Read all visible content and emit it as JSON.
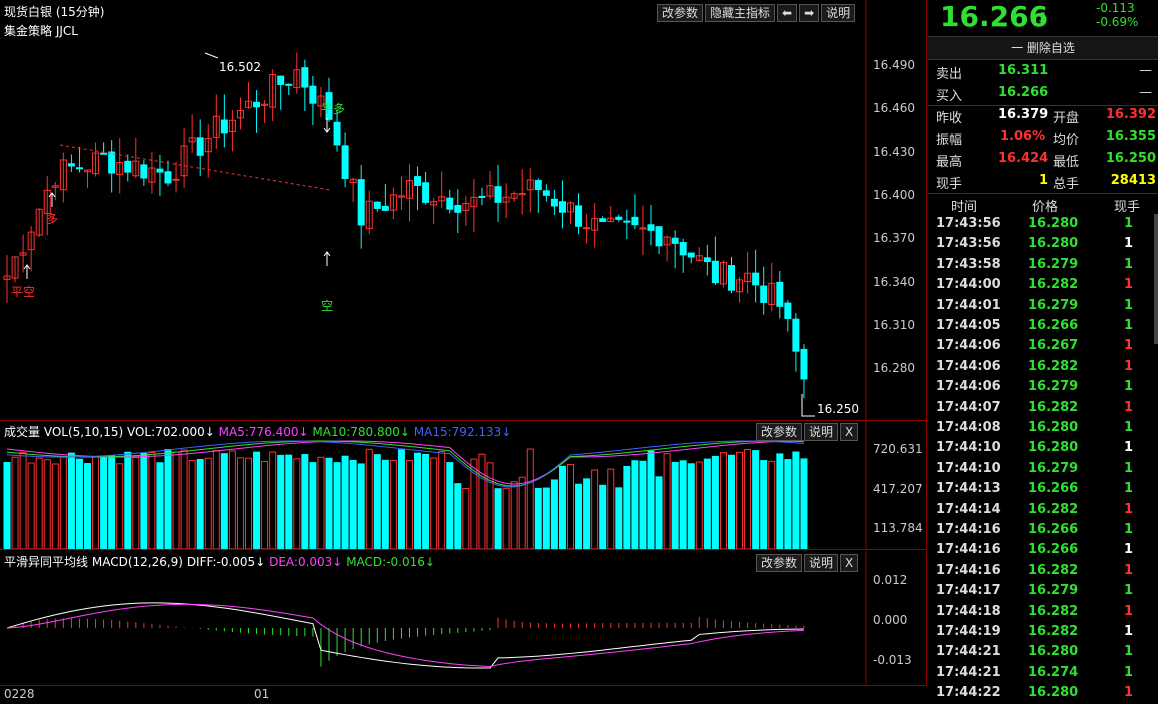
{
  "main": {
    "title": "现货白银 (15分钟)",
    "strategy": "集金策略 JJCL",
    "buttons": [
      "改参数",
      "隐藏主指标",
      "⬅",
      "➡",
      "说明"
    ],
    "price_labels": [
      "16.490",
      "16.460",
      "16.430",
      "16.400",
      "16.370",
      "16.340",
      "16.310",
      "16.280"
    ],
    "high_mark": "16.502",
    "low_mark": "16.250",
    "signals": [
      {
        "text": "平空",
        "color": "#ff3030"
      },
      {
        "text": "多",
        "color": "#ff3030"
      },
      {
        "text": "平多",
        "color": "#30e030"
      },
      {
        "text": "空",
        "color": "#30e030"
      }
    ]
  },
  "volume": {
    "title": "成交量",
    "params": "VOL(5,10,15)",
    "vol": "VOL:702.000↓",
    "ma5": "MA5:776.400↓",
    "ma10": "MA10:780.800↓",
    "ma15": "MA15:792.133↓",
    "buttons": [
      "改参数",
      "说明",
      "X"
    ],
    "axis_labels": [
      "720.631",
      "417.207",
      "113.784"
    ]
  },
  "macd": {
    "title": "平滑异同平均线",
    "params": "MACD(12,26,9)",
    "diff": "DIFF:-0.005↓",
    "dea": "DEA:0.003↓",
    "macd": "MACD:-0.016↓",
    "buttons": [
      "改参数",
      "说明",
      "X"
    ],
    "axis_labels": [
      "0.012",
      "0.000",
      "-0.013"
    ]
  },
  "date_labels": [
    "0228",
    "01"
  ],
  "colors": {
    "up": "#ff3030",
    "down": "#00ffff",
    "green": "#30e030",
    "yellow": "#ffff00",
    "magenta": "#ff40ff",
    "blue": "#4060ff"
  },
  "quote": {
    "price": "16.266",
    "arrow": "⬇",
    "change": "-0.113",
    "change_pct": "-0.69%",
    "delete_label": "一 删除自选",
    "sell_label": "卖出",
    "sell_price": "16.311",
    "sell_vol": "—",
    "buy_label": "买入",
    "buy_price": "16.266",
    "buy_vol": "—",
    "prev_close_label": "昨收",
    "prev_close": "16.379",
    "open_label": "开盘",
    "open": "16.392",
    "amplitude_label": "振幅",
    "amplitude": "1.06%",
    "avg_label": "均价",
    "avg": "16.355",
    "high_label": "最高",
    "high": "16.424",
    "low_label": "最低",
    "low": "16.250",
    "cur_vol_label": "现手",
    "cur_vol": "1",
    "total_vol_label": "总手",
    "total_vol": "28413"
  },
  "ticks_header": {
    "time": "时间",
    "price": "价格",
    "vol": "现手"
  },
  "ticks": [
    {
      "time": "17:43:56",
      "price": "16.280",
      "vol": "1",
      "color": "#30e030"
    },
    {
      "time": "17:43:56",
      "price": "16.280",
      "vol": "1",
      "color": "#ffffff"
    },
    {
      "time": "17:43:58",
      "price": "16.279",
      "vol": "1",
      "color": "#30e030"
    },
    {
      "time": "17:44:00",
      "price": "16.282",
      "vol": "1",
      "color": "#ff3030"
    },
    {
      "time": "17:44:01",
      "price": "16.279",
      "vol": "1",
      "color": "#30e030"
    },
    {
      "time": "17:44:05",
      "price": "16.266",
      "vol": "1",
      "color": "#30e030"
    },
    {
      "time": "17:44:06",
      "price": "16.267",
      "vol": "1",
      "color": "#ff3030"
    },
    {
      "time": "17:44:06",
      "price": "16.282",
      "vol": "1",
      "color": "#ff3030"
    },
    {
      "time": "17:44:06",
      "price": "16.279",
      "vol": "1",
      "color": "#30e030"
    },
    {
      "time": "17:44:07",
      "price": "16.282",
      "vol": "1",
      "color": "#ff3030"
    },
    {
      "time": "17:44:08",
      "price": "16.280",
      "vol": "1",
      "color": "#30e030"
    },
    {
      "time": "17:44:10",
      "price": "16.280",
      "vol": "1",
      "color": "#ffffff"
    },
    {
      "time": "17:44:10",
      "price": "16.279",
      "vol": "1",
      "color": "#30e030"
    },
    {
      "time": "17:44:13",
      "price": "16.266",
      "vol": "1",
      "color": "#30e030"
    },
    {
      "time": "17:44:14",
      "price": "16.282",
      "vol": "1",
      "color": "#ff3030"
    },
    {
      "time": "17:44:16",
      "price": "16.266",
      "vol": "1",
      "color": "#30e030"
    },
    {
      "time": "17:44:16",
      "price": "16.266",
      "vol": "1",
      "color": "#ffffff"
    },
    {
      "time": "17:44:16",
      "price": "16.282",
      "vol": "1",
      "color": "#ff3030"
    },
    {
      "time": "17:44:17",
      "price": "16.279",
      "vol": "1",
      "color": "#30e030"
    },
    {
      "time": "17:44:18",
      "price": "16.282",
      "vol": "1",
      "color": "#ff3030"
    },
    {
      "time": "17:44:19",
      "price": "16.282",
      "vol": "1",
      "color": "#ffffff"
    },
    {
      "time": "17:44:21",
      "price": "16.280",
      "vol": "1",
      "color": "#30e030"
    },
    {
      "time": "17:44:21",
      "price": "16.274",
      "vol": "1",
      "color": "#30e030"
    },
    {
      "time": "17:44:22",
      "price": "16.280",
      "vol": "1",
      "color": "#ff3030"
    }
  ]
}
